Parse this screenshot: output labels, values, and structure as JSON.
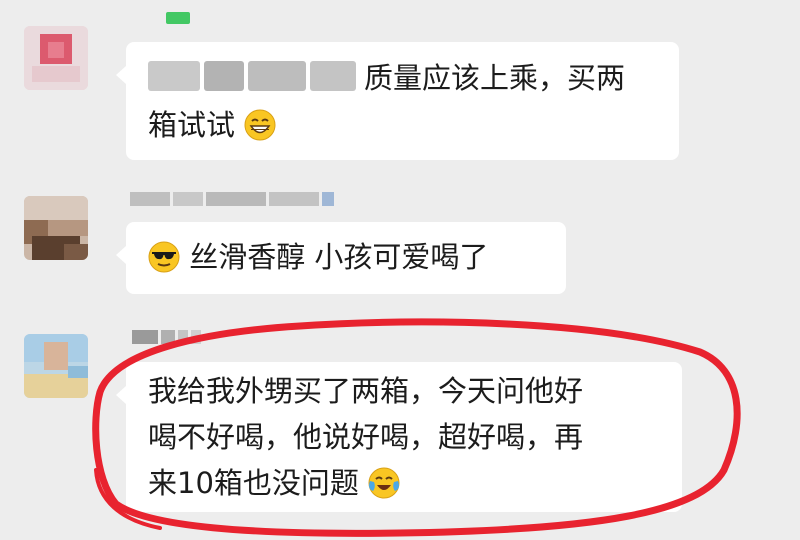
{
  "messages": [
    {
      "text_after_blur": "质量应该上乘，买两",
      "line2": "箱试试",
      "emoji": "grinning-face-icon"
    },
    {
      "emoji": "sunglasses-face-icon",
      "text": "丝滑香醇 小孩可爱喝了"
    },
    {
      "lines": [
        "我给我外甥买了两箱，今天问他好",
        "喝不好喝，他说好喝，超好喝，再",
        "来10箱也没问题"
      ],
      "emoji": "tears-of-joy-face-icon"
    }
  ],
  "colors": {
    "background": "#ededed",
    "bubble": "#ffffff",
    "highlight_circle": "#e8232f",
    "text": "#1c1c1c"
  }
}
